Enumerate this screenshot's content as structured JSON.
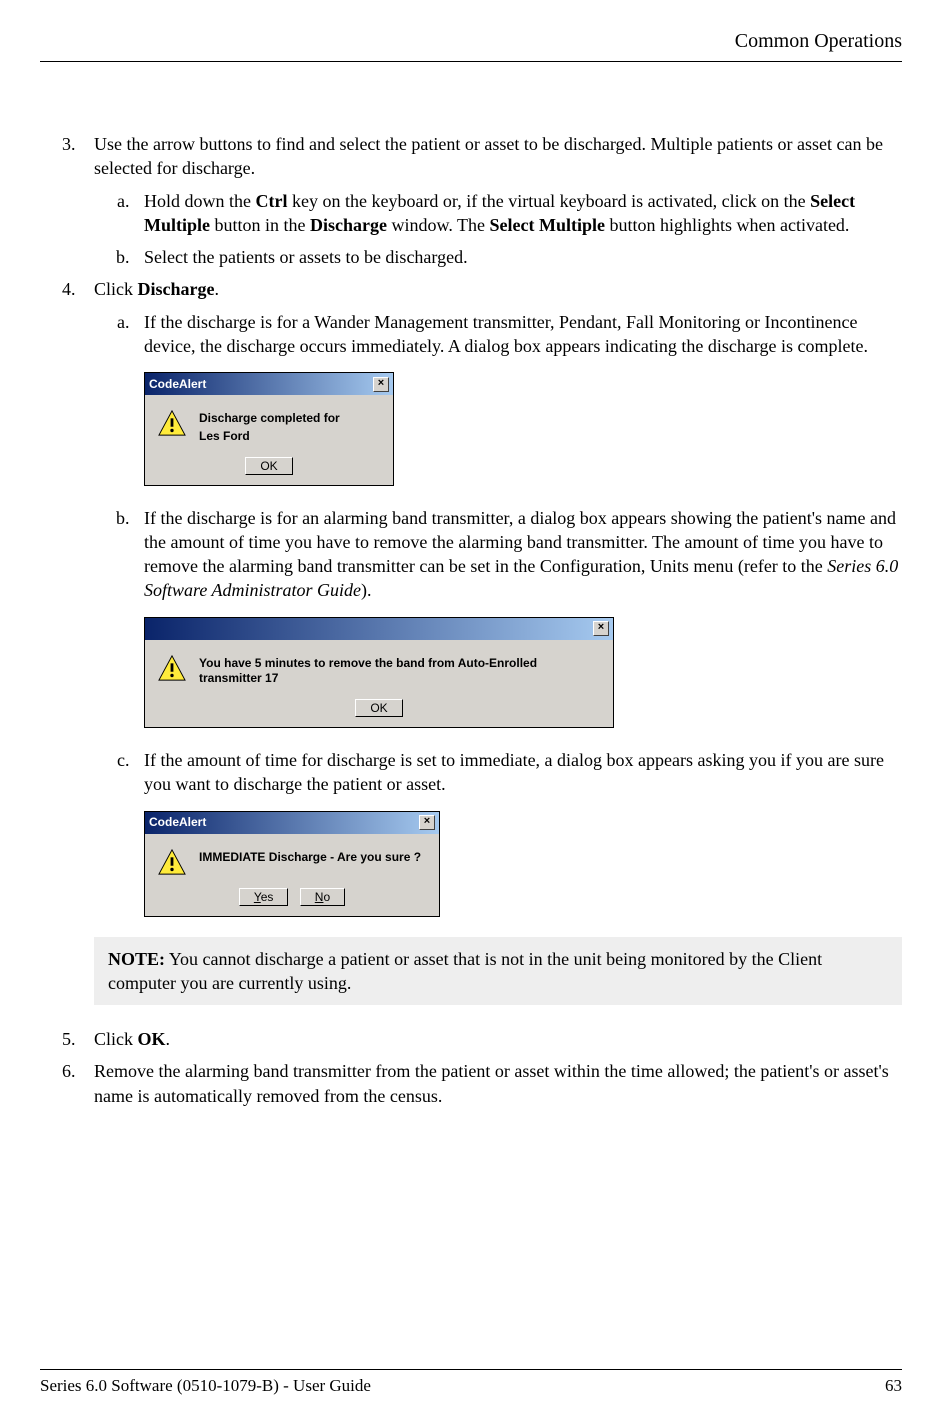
{
  "header": "Common Operations",
  "steps": {
    "s3": {
      "text": "Use the arrow buttons to find and select the patient or asset to be discharged. Multiple patients or asset can be selected for discharge.",
      "a_pre": "Hold down the ",
      "a_bold1": "Ctrl",
      "a_mid1": " key on the keyboard or, if the virtual keyboard is activated, click on the ",
      "a_bold2": "Select Multiple",
      "a_mid2": " button in the ",
      "a_bold3": "Discharge",
      "a_mid3": " window. The ",
      "a_bold4": "Select Multiple",
      "a_post": " button highlights when activated.",
      "b": "Select the patients or assets to be discharged."
    },
    "s4": {
      "text_pre": "Click ",
      "text_bold": "Discharge",
      "text_post": ".",
      "a": "If the discharge is for a Wander Management transmitter, Pendant, Fall Monitoring or Incontinence device, the discharge occurs immediately. A dialog box appears indicating the discharge is complete.",
      "b_pre": "If the discharge is for an alarming band transmitter, a dialog box appears showing the patient's name and the amount of time you have to remove the alarming band transmitter. The amount of time you have to remove the alarming band transmitter can be set in the Configuration, Units menu (refer to the ",
      "b_italic": "Series 6.0 Software Administrator Guide",
      "b_post": ").",
      "c": "If the amount of time for discharge is set to immediate, a dialog box appears asking you if you are sure you want to discharge the patient or asset."
    },
    "s5_pre": "Click ",
    "s5_bold": "OK",
    "s5_post": ".",
    "s6": "Remove the alarming band transmitter from the patient or asset within the time allowed; the patient's or asset's name is automatically removed from the census."
  },
  "dialog1": {
    "title": "CodeAlert",
    "msg1": "Discharge completed for",
    "msg2": "Les Ford",
    "ok": "OK"
  },
  "dialog2": {
    "msg": "You have 5 minutes to remove the band from Auto-Enrolled transmitter 17",
    "ok": "OK"
  },
  "dialog3": {
    "title": "CodeAlert",
    "msg": "IMMEDIATE Discharge - Are you sure ?",
    "yes_u": "Y",
    "yes_rest": "es",
    "no_u": "N",
    "no_rest": "o"
  },
  "note": {
    "label": "NOTE:",
    "text": " You cannot discharge a patient or asset that is not in the unit being monitored by the Client computer you are currently using."
  },
  "footer": {
    "left": "Series 6.0 Software (0510-1079-B) - User Guide",
    "right": "63"
  }
}
